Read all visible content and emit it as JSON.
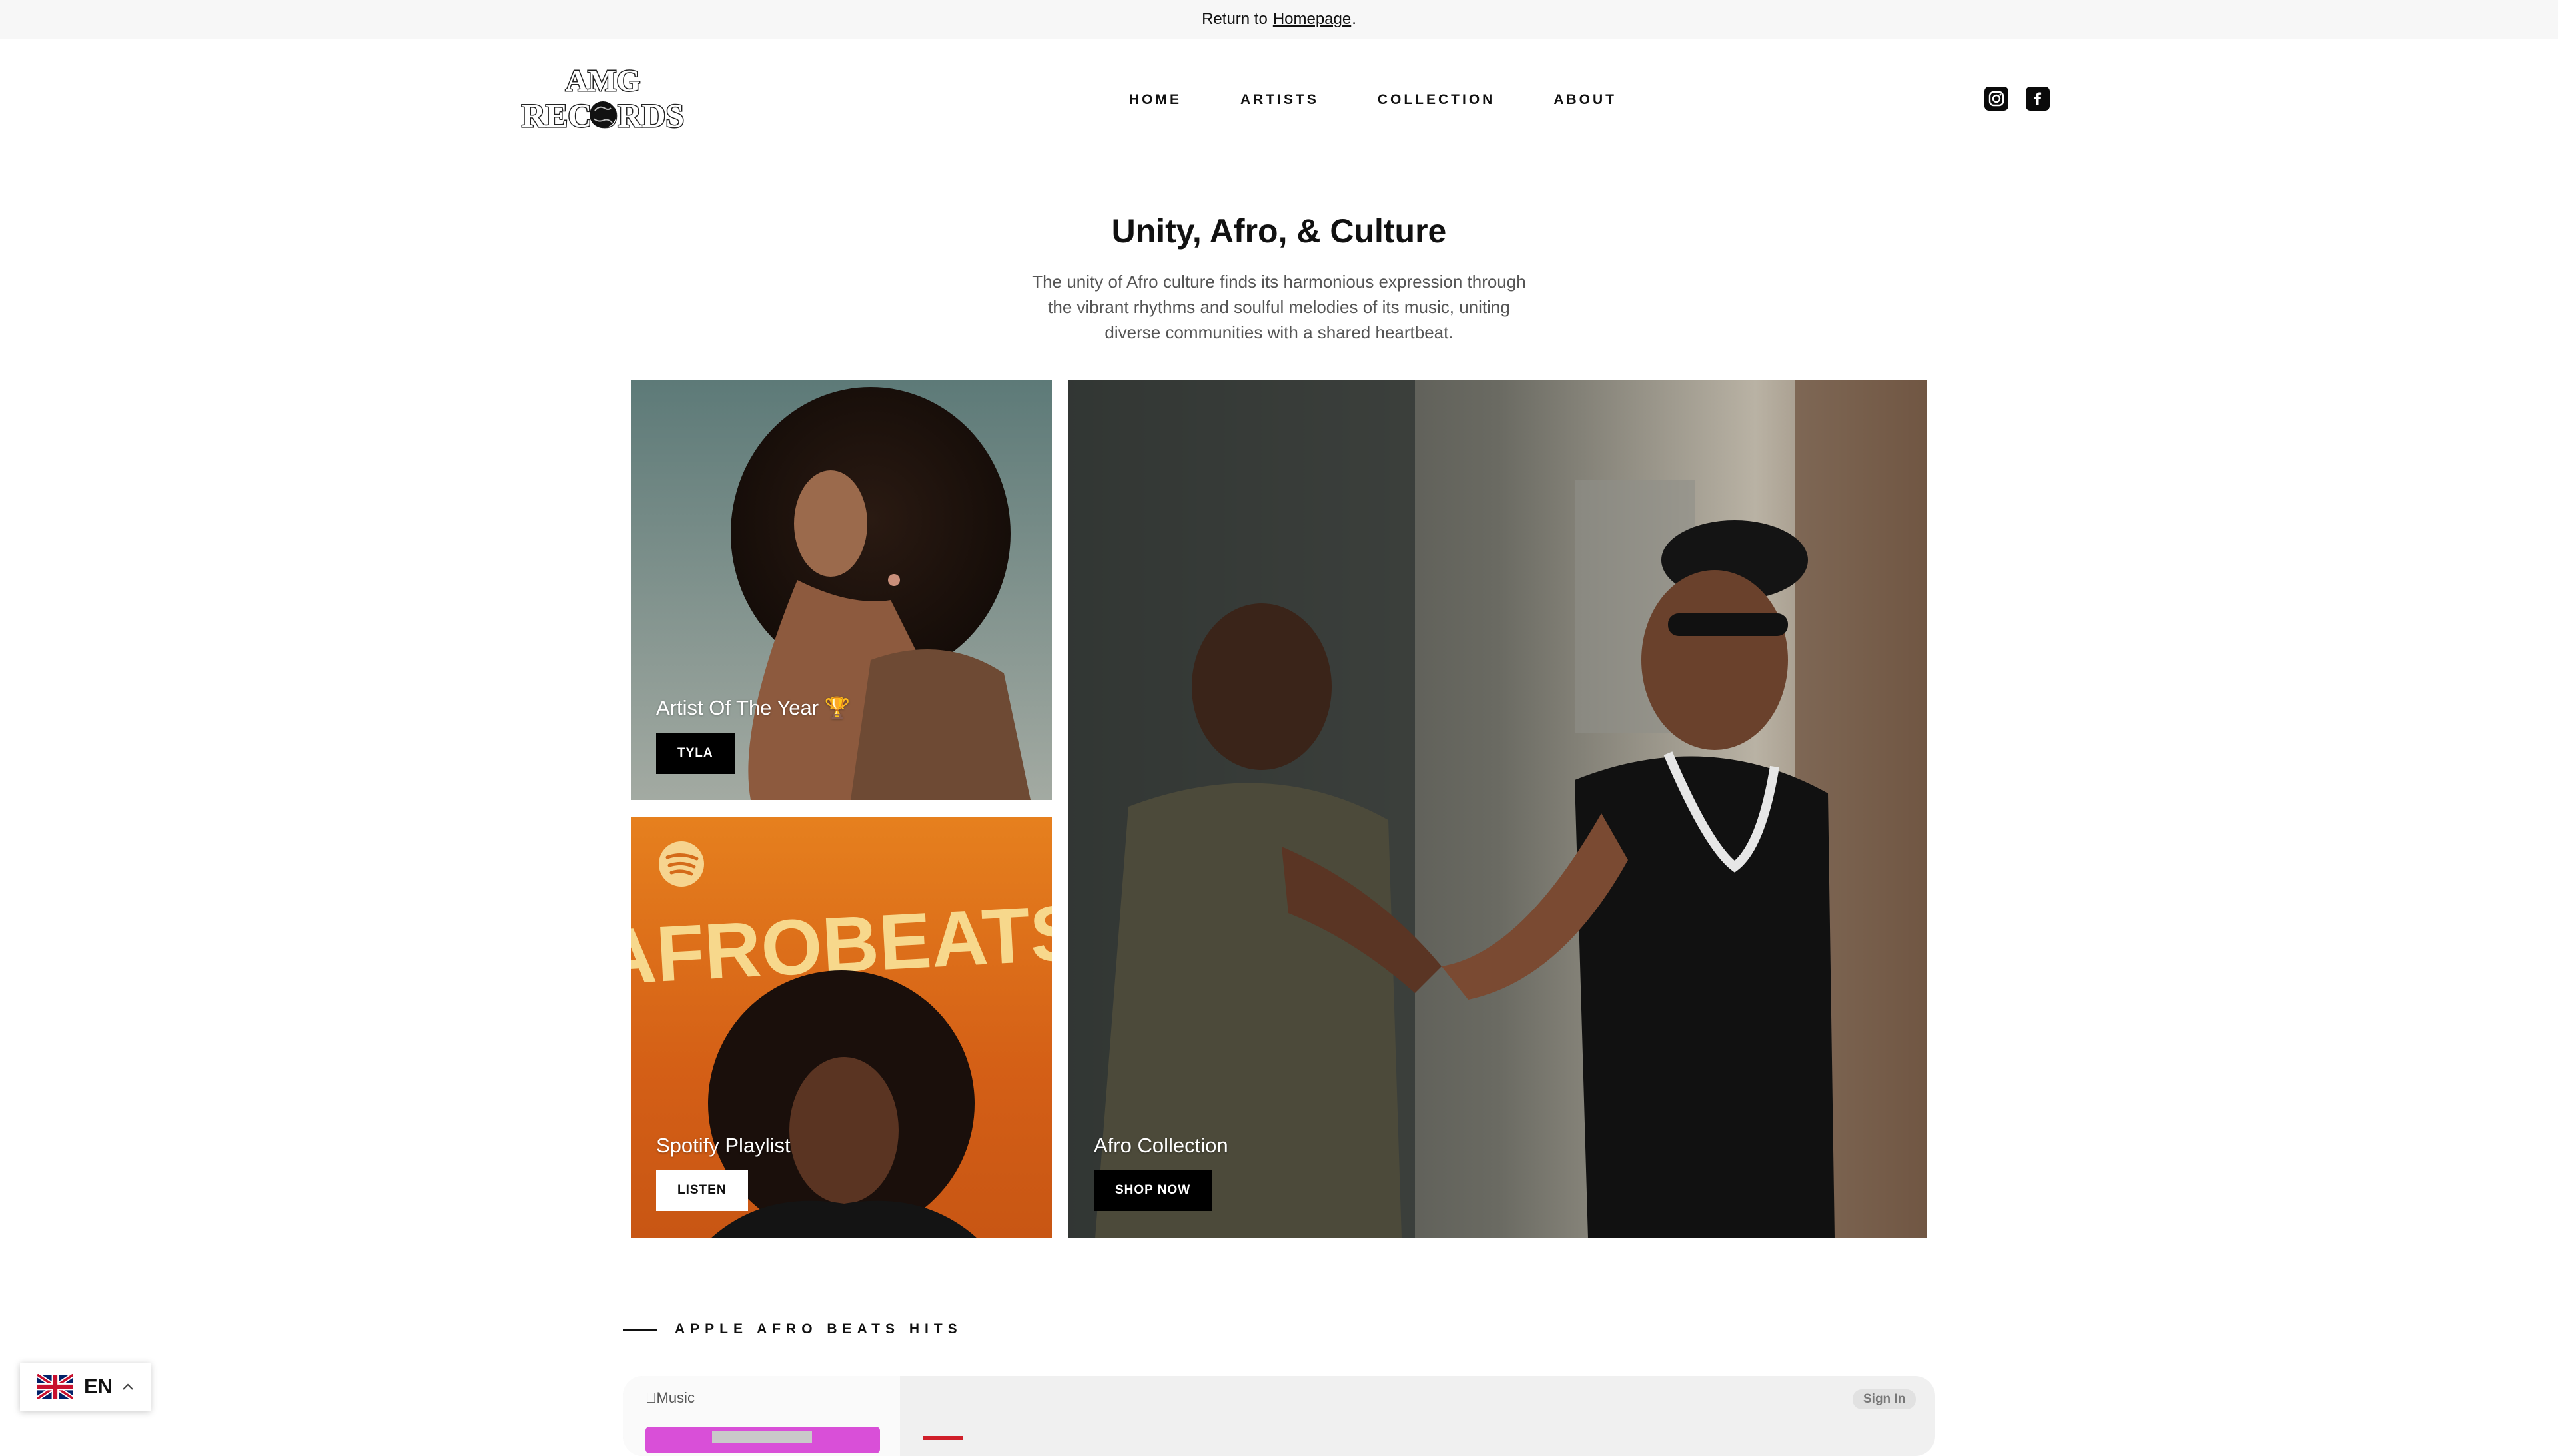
{
  "announcement": {
    "prefix": "Return to",
    "link": "Homepage",
    "suffix": "."
  },
  "brand": {
    "logo_line1": "AMG",
    "logo_line2": "RECORDS"
  },
  "nav": [
    {
      "label": "HOME"
    },
    {
      "label": "ARTISTS"
    },
    {
      "label": "COLLECTION"
    },
    {
      "label": "ABOUT"
    }
  ],
  "social": [
    {
      "icon": "instagram-icon"
    },
    {
      "icon": "facebook-icon"
    }
  ],
  "hero": {
    "title": "Unity, Afro, & Culture",
    "description": "The unity of Afro culture finds its harmonious expression through the vibrant rhythms and soulful melodies of its music, uniting diverse communities with a shared heartbeat."
  },
  "tiles": {
    "artist": {
      "label": "Artist Of The Year 🏆",
      "button": "TYLA"
    },
    "playlist": {
      "label": "Spotify Playlist",
      "button": "LISTEN",
      "art_text": "AFROBEATS"
    },
    "collection": {
      "label": "Afro Collection",
      "button": "SHOP NOW"
    }
  },
  "section": {
    "heading": "APPLE AFRO BEATS HITS"
  },
  "apple_embed": {
    "label": "Music",
    "sign_in": "Sign In"
  },
  "language": {
    "code": "EN"
  }
}
